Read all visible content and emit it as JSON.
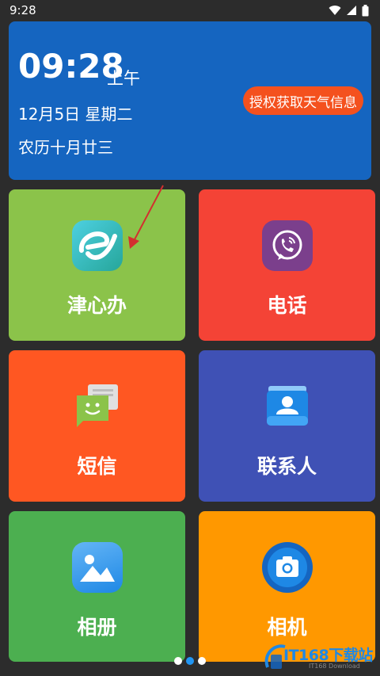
{
  "status_bar": {
    "time": "9:28",
    "icons": [
      "wifi-icon",
      "signal-icon",
      "battery-icon"
    ]
  },
  "clock": {
    "time": "09:28",
    "ampm": "上午",
    "date": "12月5日 星期二",
    "lunar": "农历十月廿三",
    "weather_button": "授权获取天气信息"
  },
  "tiles": [
    {
      "label": "津心办",
      "icon": "jinxinban-app-icon",
      "color": "#8bc34a"
    },
    {
      "label": "电话",
      "icon": "phone-icon",
      "color": "#f44336"
    },
    {
      "label": "短信",
      "icon": "message-icon",
      "color": "#ff5722"
    },
    {
      "label": "联系人",
      "icon": "contacts-icon",
      "color": "#3f51b5"
    },
    {
      "label": "相册",
      "icon": "gallery-icon",
      "color": "#4caf50"
    },
    {
      "label": "相机",
      "icon": "camera-icon",
      "color": "#ff9800"
    }
  ],
  "pagination": {
    "pages": 3,
    "active": 2
  },
  "watermark": {
    "text": "IT168下载站",
    "sub": "IT168 Download"
  }
}
